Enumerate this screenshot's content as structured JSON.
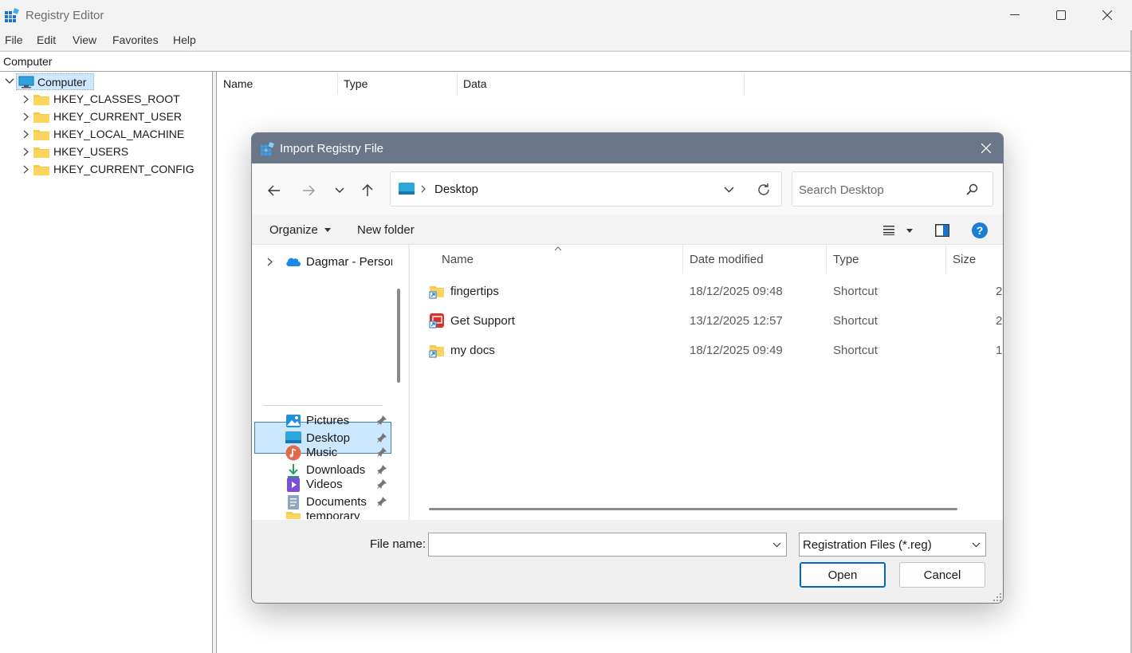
{
  "window": {
    "title": "Registry Editor",
    "menu": [
      "File",
      "Edit",
      "View",
      "Favorites",
      "Help"
    ],
    "address": "Computer"
  },
  "tree": {
    "root": "Computer",
    "keys": [
      "HKEY_CLASSES_ROOT",
      "HKEY_CURRENT_USER",
      "HKEY_LOCAL_MACHINE",
      "HKEY_USERS",
      "HKEY_CURRENT_CONFIG"
    ]
  },
  "list_columns": [
    "Name",
    "Type",
    "Data"
  ],
  "dialog": {
    "title": "Import Registry File",
    "location": "Desktop",
    "search_placeholder": "Search Desktop",
    "toolbar": {
      "organize": "Organize",
      "new_folder": "New folder"
    },
    "nav": {
      "onedrive": "Dagmar - Personal",
      "items": [
        {
          "label": "Desktop",
          "icon": "desktop-icon"
        },
        {
          "label": "Downloads",
          "icon": "download-icon"
        },
        {
          "label": "Documents",
          "icon": "documents-icon"
        },
        {
          "label": "Pictures",
          "icon": "pictures-icon"
        },
        {
          "label": "Music",
          "icon": "music-icon"
        },
        {
          "label": "Videos",
          "icon": "videos-icon"
        },
        {
          "label": "temporary",
          "icon": "folder-icon"
        }
      ]
    },
    "file_columns": [
      "Name",
      "Date modified",
      "Type",
      "Size"
    ],
    "files": [
      {
        "name": "fingertips",
        "date": "18/12/2025 09:48",
        "type": "Shortcut",
        "size": "2",
        "icon": "folder-shortcut-icon"
      },
      {
        "name": "Get Support",
        "date": "13/12/2025 12:57",
        "type": "Shortcut",
        "size": "2",
        "icon": "app-shortcut-icon"
      },
      {
        "name": "my docs",
        "date": "18/12/2025 09:49",
        "type": "Shortcut",
        "size": "1",
        "icon": "folder-shortcut-icon"
      }
    ],
    "file_name_label": "File name:",
    "file_name_value": "",
    "file_type": "Registration Files (*.reg)",
    "open_label": "Open",
    "cancel_label": "Cancel"
  },
  "colors": {
    "accent": "#0067c0",
    "dialog_titlebar": "#6b7788",
    "selection": "#cce8ff",
    "folder": "#f8c94a"
  }
}
